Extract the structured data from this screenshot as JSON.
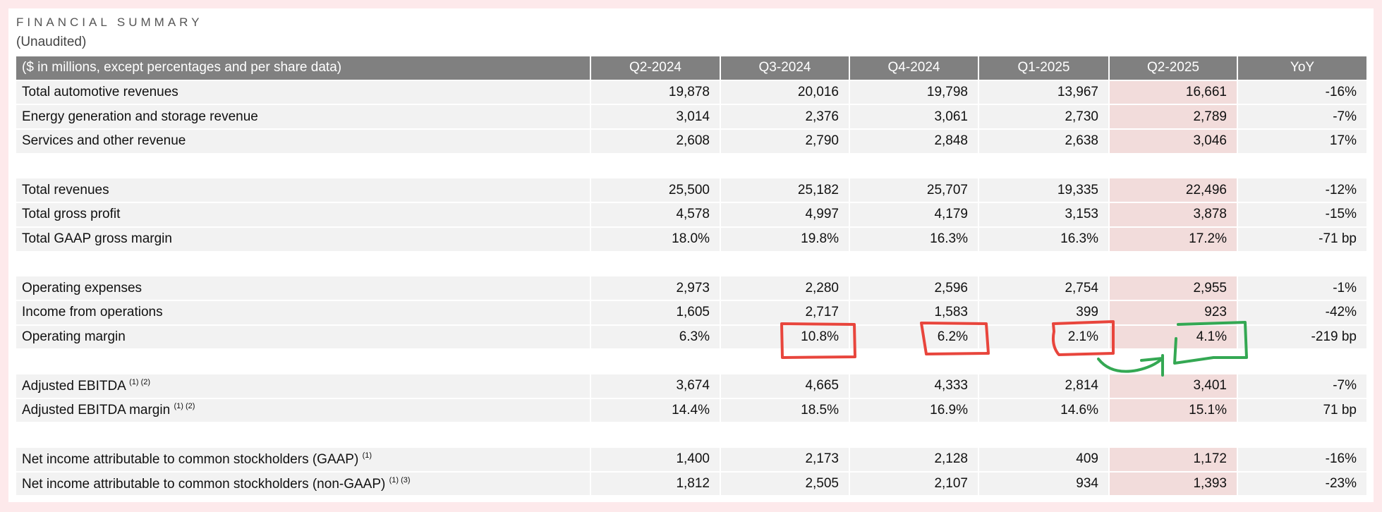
{
  "title": "FINANCIAL SUMMARY",
  "subtitle": "(Unaudited)",
  "header": {
    "label": "($ in millions, except percentages and per share data)",
    "columns": [
      "Q2-2024",
      "Q3-2024",
      "Q4-2024",
      "Q1-2025",
      "Q2-2025",
      "YoY"
    ]
  },
  "rows": [
    {
      "label": "Total automotive revenues",
      "sup": "",
      "values": [
        "19,878",
        "20,016",
        "19,798",
        "13,967",
        "16,661",
        "-16%"
      ]
    },
    {
      "label": "Energy generation and storage revenue",
      "sup": "",
      "values": [
        "3,014",
        "2,376",
        "3,061",
        "2,730",
        "2,789",
        "-7%"
      ]
    },
    {
      "label": "Services and other revenue",
      "sup": "",
      "values": [
        "2,608",
        "2,790",
        "2,848",
        "2,638",
        "3,046",
        "17%"
      ]
    },
    null,
    {
      "label": "Total revenues",
      "sup": "",
      "values": [
        "25,500",
        "25,182",
        "25,707",
        "19,335",
        "22,496",
        "-12%"
      ]
    },
    {
      "label": "Total gross profit",
      "sup": "",
      "values": [
        "4,578",
        "4,997",
        "4,179",
        "3,153",
        "3,878",
        "-15%"
      ]
    },
    {
      "label": "Total GAAP gross margin",
      "sup": "",
      "values": [
        "18.0%",
        "19.8%",
        "16.3%",
        "16.3%",
        "17.2%",
        "-71 bp"
      ]
    },
    null,
    {
      "label": "Operating expenses",
      "sup": "",
      "values": [
        "2,973",
        "2,280",
        "2,596",
        "2,754",
        "2,955",
        "-1%"
      ]
    },
    {
      "label": "Income from operations",
      "sup": "",
      "values": [
        "1,605",
        "2,717",
        "1,583",
        "399",
        "923",
        "-42%"
      ]
    },
    {
      "label": "Operating margin",
      "sup": "",
      "values": [
        "6.3%",
        "10.8%",
        "6.2%",
        "2.1%",
        "4.1%",
        "-219 bp"
      ]
    },
    null,
    {
      "label": "Adjusted EBITDA",
      "sup": "(1) (2)",
      "values": [
        "3,674",
        "4,665",
        "4,333",
        "2,814",
        "3,401",
        "-7%"
      ]
    },
    {
      "label": "Adjusted EBITDA margin",
      "sup": "(1) (2)",
      "values": [
        "14.4%",
        "18.5%",
        "16.9%",
        "14.6%",
        "15.1%",
        "71 bp"
      ]
    },
    null,
    {
      "label": "Net income attributable to common stockholders (GAAP)",
      "sup": "(1)",
      "values": [
        "1,400",
        "2,173",
        "2,128",
        "409",
        "1,172",
        "-16%"
      ]
    },
    {
      "label": "Net income attributable to common stockholders (non-GAAP)",
      "sup": "(1) (3)",
      "values": [
        "1,812",
        "2,505",
        "2,107",
        "934",
        "1,393",
        "-23%"
      ]
    }
  ],
  "colors": {
    "header": "#808080",
    "row": "#f2f2f2",
    "highlight": "#f2dcdb",
    "annotation_red": "#e8453c",
    "annotation_green": "#34a853"
  }
}
